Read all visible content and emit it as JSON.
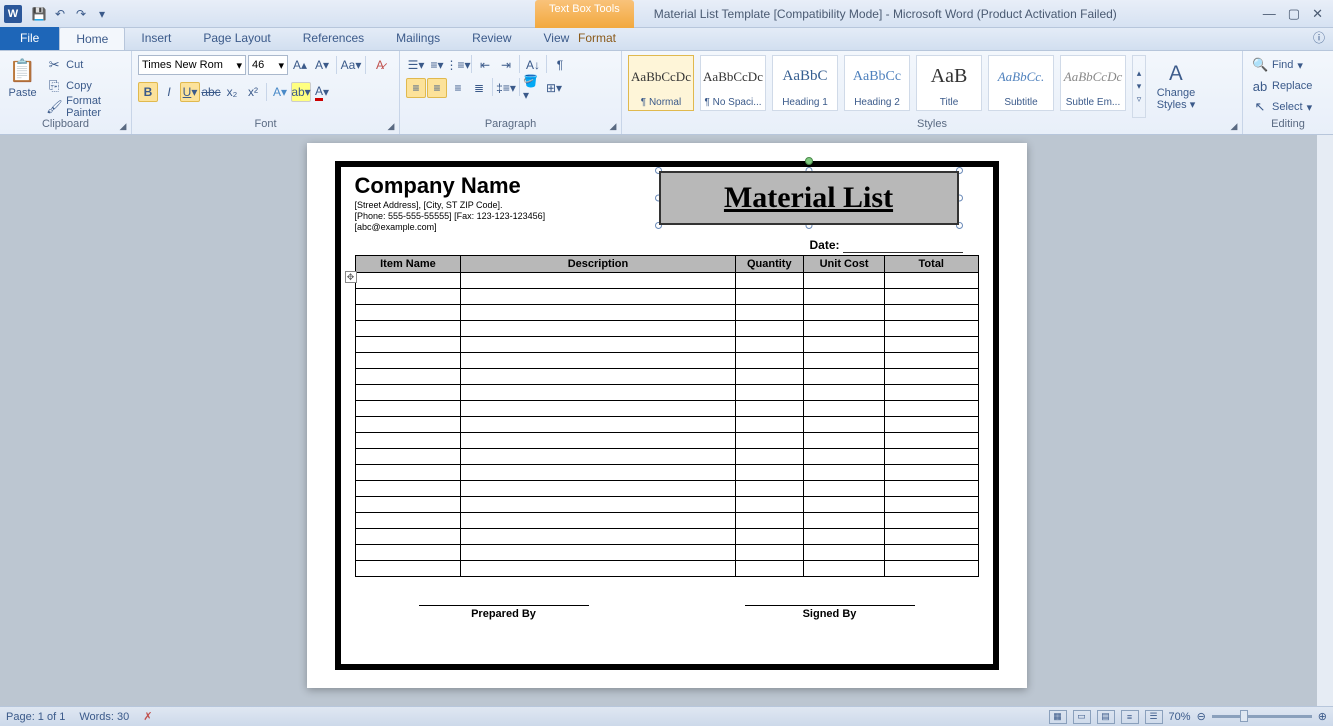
{
  "titlebar": {
    "title": "Material List Template [Compatibility Mode] - Microsoft Word (Product Activation Failed)",
    "context_group": "Text Box Tools"
  },
  "tabs": {
    "file": "File",
    "items": [
      "Home",
      "Insert",
      "Page Layout",
      "References",
      "Mailings",
      "Review",
      "View"
    ],
    "context": "Format",
    "active": "Home"
  },
  "ribbon": {
    "clipboard": {
      "label": "Clipboard",
      "paste": "Paste",
      "cut": "Cut",
      "copy": "Copy",
      "format_painter": "Format Painter"
    },
    "font": {
      "label": "Font",
      "name": "Times New Rom",
      "size": "46"
    },
    "paragraph": {
      "label": "Paragraph"
    },
    "styles": {
      "label": "Styles",
      "change": "Change Styles",
      "items": [
        {
          "preview": "AaBbCcDc",
          "name": "¶ Normal"
        },
        {
          "preview": "AaBbCcDc",
          "name": "¶ No Spaci..."
        },
        {
          "preview": "AaBbC",
          "name": "Heading 1"
        },
        {
          "preview": "AaBbCc",
          "name": "Heading 2"
        },
        {
          "preview": "AaB",
          "name": "Title"
        },
        {
          "preview": "AaBbCc.",
          "name": "Subtitle"
        },
        {
          "preview": "AaBbCcDc",
          "name": "Subtle Em..."
        }
      ]
    },
    "editing": {
      "label": "Editing",
      "find": "Find",
      "replace": "Replace",
      "select": "Select"
    }
  },
  "document": {
    "company_name": "Company Name",
    "address": "[Street Address], [City, ST ZIP Code].",
    "phone": "[Phone: 555-555-55555] [Fax: 123-123-123456]",
    "email": "[abc@example.com]",
    "title_box": "Material List",
    "date_label": "Date:",
    "headers": [
      "Item Name",
      "Description",
      "Quantity",
      "Unit Cost",
      "Total"
    ],
    "prepared": "Prepared By",
    "signed": "Signed By"
  },
  "statusbar": {
    "page": "Page: 1 of 1",
    "words": "Words: 30",
    "zoom": "70%"
  }
}
